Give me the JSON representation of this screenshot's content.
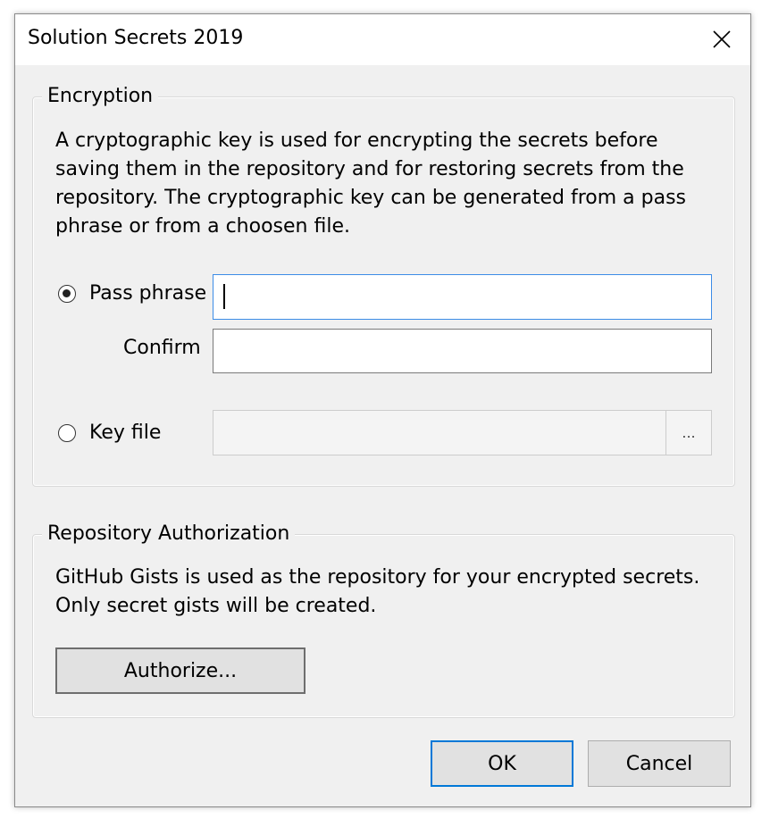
{
  "window": {
    "title": "Solution Secrets 2019"
  },
  "encryption": {
    "legend": "Encryption",
    "description_lines": [
      "A cryptographic key is used for encrypting the secrets before",
      "saving them in the repository and for restoring secrets from the",
      "repository. The cryptographic key can be generated from a pass",
      "phrase or from a choosen file."
    ],
    "pass_phrase_label": "Pass phrase",
    "pass_phrase_value": "",
    "pass_phrase_selected": true,
    "confirm_label": "Confirm",
    "confirm_value": "",
    "key_file_label": "Key file",
    "key_file_value": "",
    "key_file_selected": false,
    "browse_label": "..."
  },
  "repository": {
    "legend": "Repository Authorization",
    "description_lines": [
      "GitHub Gists is used as the repository for your encrypted secrets.",
      "Only secret gists will be created."
    ],
    "authorize_label": "Authorize..."
  },
  "buttons": {
    "ok_label": "OK",
    "cancel_label": "Cancel"
  },
  "colors": {
    "accent": "#0078d7",
    "background": "#f0f0f0",
    "focus_border": "#3c8ce7"
  }
}
